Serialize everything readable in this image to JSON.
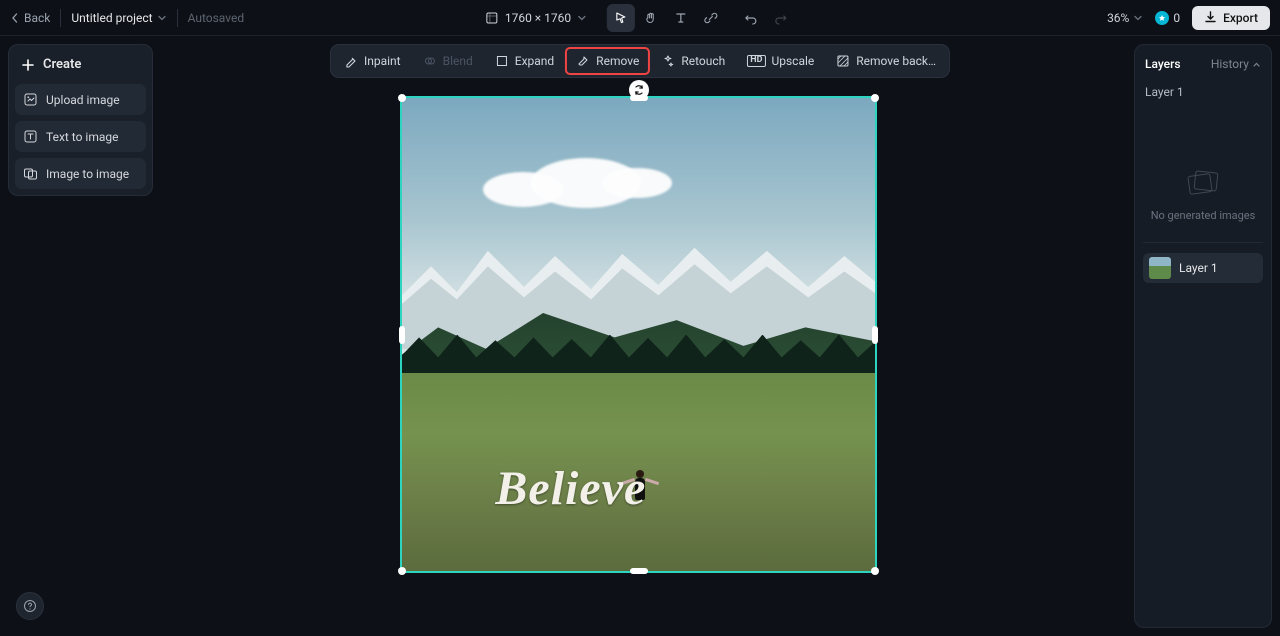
{
  "header": {
    "back": "Back",
    "project": "Untitled project",
    "autosaved": "Autosaved",
    "dimensions": "1760 × 1760",
    "zoom": "36%",
    "credits": "0",
    "export": "Export"
  },
  "left": {
    "create": "Create",
    "upload": "Upload image",
    "text2img": "Text to image",
    "img2img": "Image to image"
  },
  "actions": {
    "inpaint": "Inpaint",
    "blend": "Blend",
    "expand": "Expand",
    "remove": "Remove",
    "retouch": "Retouch",
    "upscale": "Upscale",
    "removebg": "Remove back…"
  },
  "canvas": {
    "overlay_text": "Believe"
  },
  "right": {
    "layers_tab": "Layers",
    "history_tab": "History",
    "current_layer": "Layer 1",
    "empty_msg": "No generated images",
    "layer_item": "Layer 1"
  }
}
